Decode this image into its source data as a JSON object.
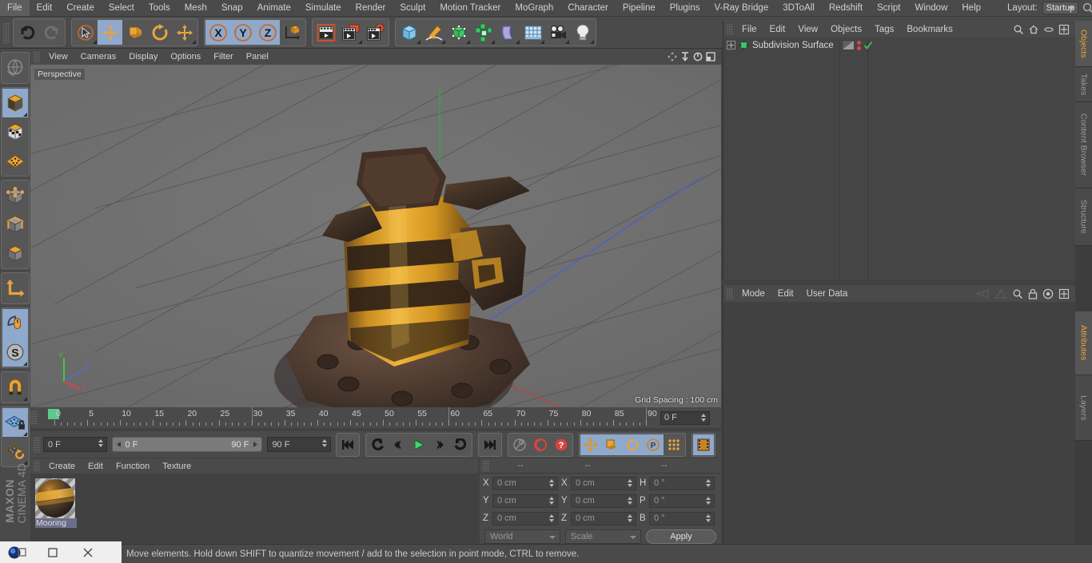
{
  "app": {
    "title": "MAXON CINEMA 4D",
    "brand_line1": "MAXON",
    "brand_line2": "CINEMA 4D"
  },
  "menubar": {
    "items": [
      "File",
      "Edit",
      "Create",
      "Select",
      "Tools",
      "Mesh",
      "Snap",
      "Animate",
      "Simulate",
      "Render",
      "Sculpt",
      "Motion Tracker",
      "MoGraph",
      "Character",
      "Pipeline",
      "Plugins",
      "V-Ray Bridge",
      "3DToAll",
      "Redshift",
      "Script",
      "Window",
      "Help"
    ],
    "layout_label": "Layout:",
    "layout_value": "Startup",
    "right_icons": [
      "search-icon",
      "home-icon",
      "minimize-icon",
      "maximize-icon"
    ]
  },
  "toolbar": {
    "groups": [
      {
        "name": "history",
        "buttons": [
          {
            "icon": "undo-icon",
            "selected": false,
            "corner": false
          },
          {
            "icon": "redo-icon",
            "selected": false,
            "corner": false
          }
        ]
      },
      {
        "name": "tools",
        "buttons": [
          {
            "icon": "live-selection-icon",
            "selected": false,
            "corner": true
          },
          {
            "icon": "move-icon",
            "selected": true,
            "corner": false
          },
          {
            "icon": "scale-icon",
            "selected": false,
            "corner": false
          },
          {
            "icon": "rotate-icon",
            "selected": false,
            "corner": false
          },
          {
            "icon": "move-alt-icon",
            "selected": false,
            "corner": true
          }
        ]
      },
      {
        "name": "axis-locks",
        "buttons": [
          {
            "icon": "axis-x-icon",
            "selected": true,
            "corner": false
          },
          {
            "icon": "axis-y-icon",
            "selected": true,
            "corner": false
          },
          {
            "icon": "axis-z-icon",
            "selected": true,
            "corner": false
          },
          {
            "icon": "world-coordinates-icon",
            "selected": false,
            "corner": false
          }
        ]
      },
      {
        "name": "render",
        "buttons": [
          {
            "icon": "render-view-icon",
            "selected": false,
            "corner": false
          },
          {
            "icon": "render-to-picture-viewer-icon",
            "selected": false,
            "corner": true
          },
          {
            "icon": "render-settings-icon",
            "selected": false,
            "corner": false
          }
        ]
      },
      {
        "name": "objects",
        "buttons": [
          {
            "icon": "cube-primitive-icon",
            "selected": false,
            "corner": true
          },
          {
            "icon": "spline-pen-icon",
            "selected": false,
            "corner": true
          },
          {
            "icon": "generator-nurbs-icon",
            "selected": false,
            "corner": true
          },
          {
            "icon": "array-modeling-icon",
            "selected": false,
            "corner": true
          },
          {
            "icon": "deformer-bend-icon",
            "selected": false,
            "corner": true
          },
          {
            "icon": "environment-floor-icon",
            "selected": false,
            "corner": true
          },
          {
            "icon": "camera-icon",
            "selected": false,
            "corner": true
          },
          {
            "icon": "light-icon",
            "selected": false,
            "corner": true
          }
        ]
      }
    ]
  },
  "left_toolbar": {
    "groups": [
      {
        "name": "undo-view",
        "buttons": [
          {
            "icon": "undo-view-icon",
            "selected": false,
            "corner": false
          }
        ]
      },
      {
        "name": "edit-modes",
        "buttons": [
          {
            "icon": "model-mode-icon",
            "selected": true,
            "corner": true
          },
          {
            "icon": "texture-mode-icon",
            "selected": false,
            "corner": false
          },
          {
            "icon": "workplane-mode-icon",
            "selected": false,
            "corner": false
          }
        ]
      },
      {
        "name": "component-modes",
        "buttons": [
          {
            "icon": "point-mode-icon",
            "selected": false,
            "corner": false
          },
          {
            "icon": "edge-mode-icon",
            "selected": false,
            "corner": false
          },
          {
            "icon": "polygon-mode-icon",
            "selected": false,
            "corner": false
          }
        ]
      },
      {
        "name": "axis",
        "buttons": [
          {
            "icon": "enable-axis-icon",
            "selected": false,
            "corner": false
          }
        ]
      },
      {
        "name": "snap-group",
        "buttons": [
          {
            "icon": "viewport-solo-icon",
            "selected": true,
            "corner": false
          },
          {
            "icon": "snap-icon",
            "selected": true,
            "corner": true
          }
        ]
      },
      {
        "name": "magnet",
        "buttons": [
          {
            "icon": "magnet-icon",
            "selected": false,
            "corner": true
          }
        ]
      },
      {
        "name": "workplane",
        "buttons": [
          {
            "icon": "workplane-lock-icon",
            "selected": true,
            "corner": true
          },
          {
            "icon": "workplane-rotate-icon",
            "selected": false,
            "corner": true
          }
        ]
      }
    ]
  },
  "viewport": {
    "menu": [
      "View",
      "Cameras",
      "Display",
      "Options",
      "Filter",
      "Panel"
    ],
    "corner_icons": [
      "pan-icon",
      "dolly-icon",
      "rotate-view-icon",
      "maximize-view-icon"
    ],
    "label": "Perspective",
    "grid_spacing": "Grid Spacing : 100 cm",
    "axis_labels": {
      "x": "X",
      "y": "Y",
      "z": "Z"
    },
    "axis_colors": {
      "x": "#e04040",
      "y": "#3ec93e",
      "z": "#4a6ef0"
    }
  },
  "timeline": {
    "ticks": [
      0,
      5,
      10,
      15,
      20,
      25,
      30,
      35,
      40,
      45,
      50,
      55,
      60,
      65,
      70,
      75,
      80,
      85,
      90
    ],
    "min_frame": 0,
    "max_frame": 90,
    "current_frame_field": "0 F"
  },
  "transport": {
    "current_frame": "0 F",
    "range_start": "0 F",
    "range_end": "90 F",
    "end_frame": "90 F",
    "buttons": [
      {
        "icon": "go-to-start-icon",
        "selected": false
      },
      {
        "icon": "previous-key-icon",
        "selected": false
      },
      {
        "icon": "step-back-icon",
        "selected": false
      },
      {
        "icon": "play-icon",
        "selected": false
      },
      {
        "icon": "step-forward-icon",
        "selected": false
      },
      {
        "icon": "next-key-icon",
        "selected": false
      },
      {
        "icon": "go-to-end-icon",
        "selected": false
      },
      {
        "icon": "record-key-icon",
        "selected": false
      },
      {
        "icon": "autokey-icon",
        "selected": false
      },
      {
        "icon": "keyframe-selection-icon",
        "selected": false
      },
      {
        "icon": "position-key-icon",
        "selected": true
      },
      {
        "icon": "scale-key-icon",
        "selected": true
      },
      {
        "icon": "rotation-key-icon",
        "selected": true
      },
      {
        "icon": "parameter-key-icon",
        "selected": true
      },
      {
        "icon": "point-level-animation-icon",
        "selected": false
      },
      {
        "icon": "timeline-icon",
        "selected": true
      }
    ]
  },
  "material_manager": {
    "menu": [
      "Create",
      "Edit",
      "Function",
      "Texture"
    ],
    "materials": [
      {
        "name": "Mooring",
        "selected": true
      }
    ]
  },
  "coordinates": {
    "headers": [
      "--",
      "--",
      "--"
    ],
    "rows": [
      {
        "pos_label": "X",
        "pos_value": "0 cm",
        "size_label": "X",
        "size_value": "0 cm",
        "rot_label": "H",
        "rot_value": "0 °"
      },
      {
        "pos_label": "Y",
        "pos_value": "0 cm",
        "size_label": "Y",
        "size_value": "0 cm",
        "rot_label": "P",
        "rot_value": "0 °"
      },
      {
        "pos_label": "Z",
        "pos_value": "0 cm",
        "size_label": "Z",
        "size_value": "0 cm",
        "rot_label": "B",
        "rot_value": "0 °"
      }
    ],
    "coord_system": "World",
    "transform_mode": "Scale",
    "apply_label": "Apply"
  },
  "object_manager": {
    "menu": [
      "File",
      "Edit",
      "View",
      "Objects",
      "Tags",
      "Bookmarks"
    ],
    "icons": [
      "search-icon",
      "home-icon",
      "ellipse-icon",
      "add-layer-icon"
    ],
    "objects": [
      {
        "name": "Subdivision Surface",
        "expandable": true,
        "visible_dots": true,
        "checked": true
      }
    ]
  },
  "attributes": {
    "menu": [
      "Mode",
      "Edit",
      "User Data"
    ],
    "icons": [
      "history-back-icon",
      "history-forward-icon",
      "search-icon",
      "lock-icon",
      "target-icon",
      "add-icon"
    ]
  },
  "vertical_tabs": [
    {
      "label": "Objects",
      "active": true
    },
    {
      "label": "Takes",
      "active": false
    },
    {
      "label": "Content Browser",
      "active": false
    },
    {
      "label": "Structure",
      "active": false
    },
    {
      "label": "Attributes",
      "active": true
    },
    {
      "label": "Layers",
      "active": false
    }
  ],
  "status_bar": {
    "text": "Move elements. Hold down SHIFT to quantize movement / add to the selection in point mode, CTRL to remove."
  },
  "taskbar": {
    "buttons": [
      "c4d-app-icon",
      "restore-icon",
      "close-icon"
    ]
  },
  "colors": {
    "panel_bg": "#414141",
    "chrome_bg": "#4a4a4a",
    "selected_blue": "#8fa9cc",
    "accent_orange": "#e8a33d",
    "viewport_bg": "#6d6d6d"
  }
}
